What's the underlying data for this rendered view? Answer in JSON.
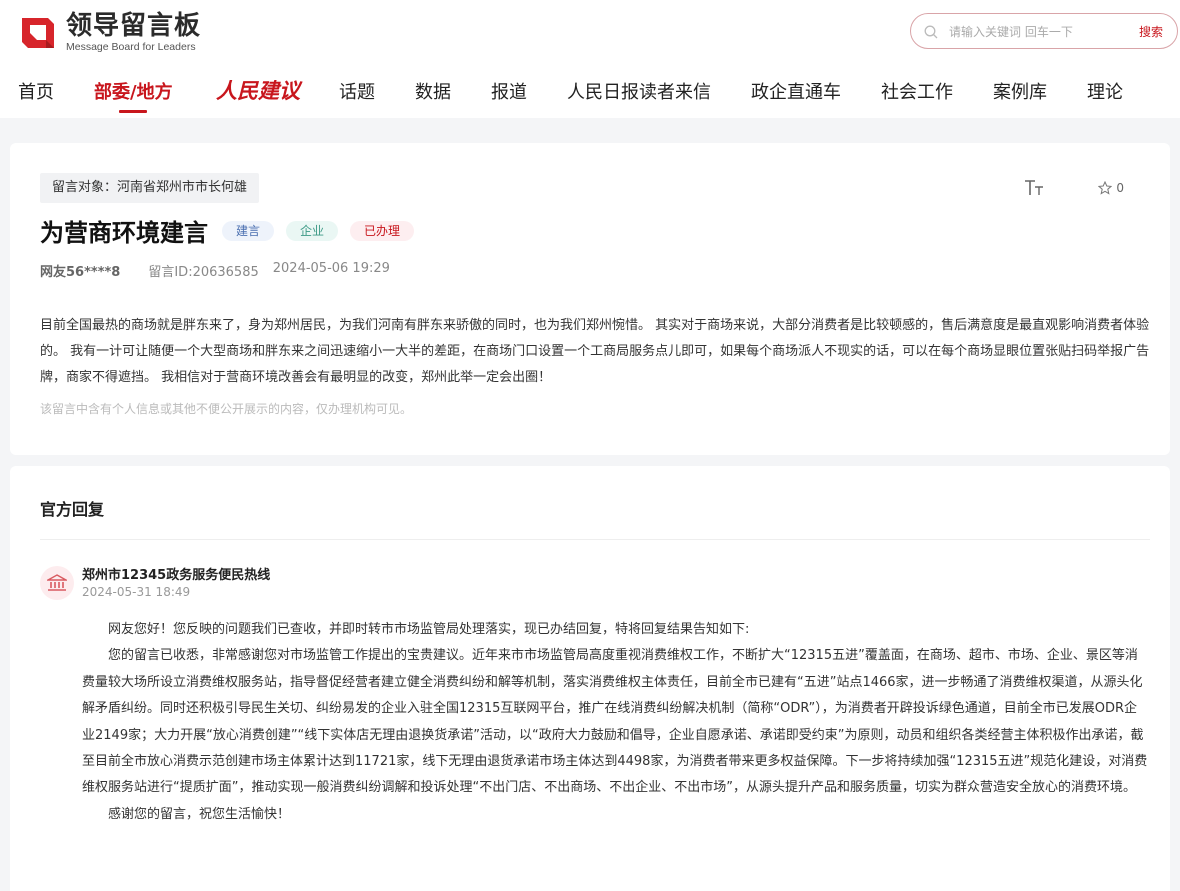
{
  "header": {
    "logo_title": "领导留言板",
    "logo_subtitle": "Message Board for Leaders",
    "search_placeholder": "请输入关键词 回车一下",
    "search_button": "搜索",
    "nav": [
      {
        "label": "首页"
      },
      {
        "label": "部委/地方"
      },
      {
        "label": "人民建议"
      },
      {
        "label": "话题"
      },
      {
        "label": "数据"
      },
      {
        "label": "报道"
      },
      {
        "label": "人民日报读者来信"
      },
      {
        "label": "政企直通车"
      },
      {
        "label": "社会工作"
      },
      {
        "label": "案例库"
      },
      {
        "label": "理论"
      }
    ],
    "active_nav": "部委/地方"
  },
  "message": {
    "target": "留言对象：河南省郑州市市长何雄",
    "title": "为营商环境建言",
    "tags": [
      "建言",
      "企业",
      "已办理"
    ],
    "author": "网友56****8",
    "id": "留言ID:20636585",
    "time": "2024-05-06 19:29",
    "star_count": "0",
    "content": "目前全国最热的商场就是胖东来了，身为郑州居民，为我们河南有胖东来骄傲的同时，也为我们郑州惋惜。 其实对于商场来说，大部分消费者是比较顿感的，售后满意度是最直观影响消费者体验的。 我有一计可让随便一个大型商场和胖东来之间迅速缩小一大半的差距，在商场门口设置一个工商局服务点儿即可，如果每个商场派人不现实的话，可以在每个商场显眼位置张贴扫码举报广告牌，商家不得遮挡。 我相信对于营商环境改善会有最明显的改变，郑州此举一定会出圈！",
    "notice": "该留言中含有个人信息或其他不便公开展示的内容，仅办理机构可见。"
  },
  "reply": {
    "heading": "官方回复",
    "org": "郑州市12345政务服务便民热线",
    "time": "2024-05-31 18:49",
    "paragraphs": [
      "网友您好！您反映的问题我们已查收，并即时转市市场监管局处理落实，现已办结回复，特将回复结果告知如下:",
      "您的留言已收悉，非常感谢您对市场监管工作提出的宝贵建议。近年来市市场监管局高度重视消费维权工作，不断扩大“12315五进”覆盖面，在商场、超市、市场、企业、景区等消费量较大场所设立消费维权服务站，指导督促经营者建立健全消费纠纷和解等机制，落实消费维权主体责任，目前全市已建有“五进”站点1466家，进一步畅通了消费维权渠道，从源头化解矛盾纠纷。同时还积极引导民生关切、纠纷易发的企业入驻全国12315互联网平台，推广在线消费纠纷解决机制（简称“ODR”），为消费者开辟投诉绿色通道，目前全市已发展ODR企业2149家；大力开展“放心消费创建”“线下实体店无理由退换货承诺”活动，以“政府大力鼓励和倡导，企业自愿承诺、承诺即受约束”为原则，动员和组织各类经营主体积极作出承诺，截至目前全市放心消费示范创建市场主体累计达到11721家，线下无理由退货承诺市场主体达到4498家，为消费者带来更多权益保障。下一步将持续加强“12315五进”规范化建设，对消费维权服务站进行“提质扩面”，推动实现一般消费纠纷调解和投诉处理“不出门店、不出商场、不出企业、不出市场”，从源头提升产品和服务质量，切实为群众营造安全放心的消费环境。",
      "感谢您的留言，祝您生活愉快！"
    ]
  },
  "colors": {
    "accent": "#c8161d",
    "background": "#f4f5f7"
  }
}
